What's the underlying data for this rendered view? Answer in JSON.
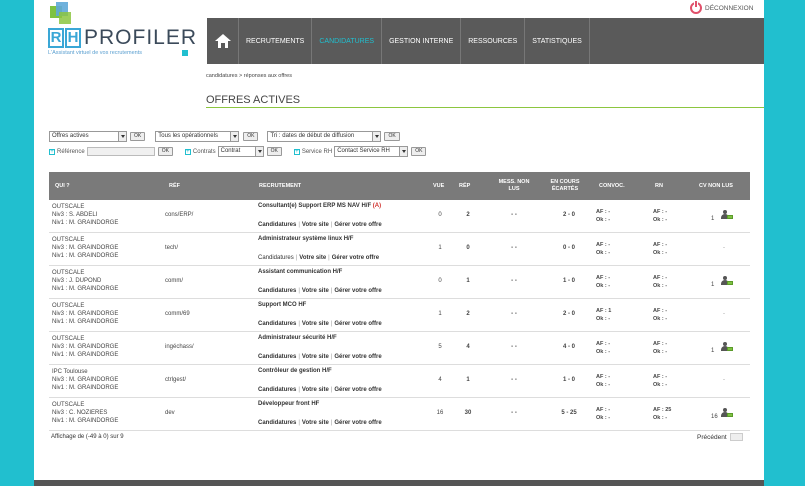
{
  "logo": {
    "rh_letters": [
      "R",
      "H"
    ],
    "name": "PROFILER",
    "tagline": "L'Assistant virtuel de vos recrutements"
  },
  "header": {
    "logout_label": "DÉCONNEXION"
  },
  "nav": {
    "items": [
      "RECRUTEMENTS",
      "CANDIDATURES",
      "GESTION INTERNE",
      "RESSOURCES",
      "STATISTIQUES"
    ],
    "active": "CANDIDATURES"
  },
  "breadcrumb": "candidatures > réponses aux offres",
  "page_title": "OFFRES ACTIVES",
  "filters": {
    "status_select": "Offres actives",
    "operationnels_select": "Tous les opérationnels",
    "tri_select": "Tri : dates de début de diffusion",
    "ok_label": "OK",
    "reference_label": "Référence",
    "contrats_label": "Contrats",
    "contrats_select": "Contrat",
    "service_label": "Service RH",
    "service_select": "Contact Service RH"
  },
  "table": {
    "headers": {
      "qui": "QUI ?",
      "ref": "RÉF",
      "recrutement": "RECRUTEMENT",
      "vue": "VUE",
      "rep": "RÉP",
      "mess": "MESS. NON LUS",
      "enc": "EN COURS ÉCARTÉS",
      "convoc": "CONVOC.",
      "rn": "RN",
      "cv": "CV NON LUS"
    },
    "links": {
      "candidatures": "Candidatures",
      "site": "Votre site",
      "gerer": "Gérer votre offre"
    },
    "rows": [
      {
        "q1": "OUTSCALE",
        "q2": "Niv3 : S. ABDELI",
        "q3": "Niv1 : M. GRAINDORGE",
        "ref": "cons/ERP/",
        "title": "Consultant(e) Support ERP MS NAV H/F",
        "alert": "(A)",
        "vue": "0",
        "rep": "2",
        "mess": "- -",
        "enc": "2 - 0",
        "af": "AF : -",
        "ok": "Ok : -",
        "rn_af": "AF : -",
        "rn_ok": "Ok : -",
        "cv": "1",
        "cv_icon": true,
        "bold": true
      },
      {
        "q1": "OUTSCALE",
        "q2": "Niv3 : M. GRAINDORGE",
        "q3": "Niv1 : M. GRAINDORGE",
        "ref": "tech/",
        "title": "Administrateur système linux H/F",
        "alert": "",
        "vue": "1",
        "rep": "0",
        "mess": "- -",
        "enc": "0 - 0",
        "af": "AF : -",
        "ok": "Ok : -",
        "rn_af": "AF : -",
        "rn_ok": "Ok : -",
        "cv": "-",
        "cv_icon": false,
        "bold": false
      },
      {
        "q1": "OUTSCALE",
        "q2": "Niv3 : J. DUPOND",
        "q3": "Niv1 : M. GRAINDORGE",
        "ref": "comm/",
        "title": "Assistant communication H/F",
        "alert": "",
        "vue": "0",
        "rep": "1",
        "mess": "- -",
        "enc": "1 - 0",
        "af": "AF : -",
        "ok": "Ok : -",
        "rn_af": "AF : -",
        "rn_ok": "Ok : -",
        "cv": "1",
        "cv_icon": true,
        "bold": true
      },
      {
        "q1": "OUTSCALE",
        "q2": "Niv3 : M. GRAINDORGE",
        "q3": "Niv1 : M. GRAINDORGE",
        "ref": "comm/69",
        "title": "Support MCO HF",
        "alert": "",
        "vue": "1",
        "rep": "2",
        "mess": "- -",
        "enc": "2 - 0",
        "af": "AF : 1",
        "ok": "Ok : -",
        "rn_af": "AF : -",
        "rn_ok": "Ok : -",
        "cv": "-",
        "cv_icon": false,
        "bold": true
      },
      {
        "q1": "OUTSCALE",
        "q2": "Niv3 : M. GRAINDORGE",
        "q3": "Niv1 : M. GRAINDORGE",
        "ref": "ingéchass/",
        "title": "Administrateur sécurité H/F",
        "alert": "",
        "vue": "5",
        "rep": "4",
        "mess": "- -",
        "enc": "4 - 0",
        "af": "AF : -",
        "ok": "Ok : -",
        "rn_af": "AF : -",
        "rn_ok": "Ok : -",
        "cv": "1",
        "cv_icon": true,
        "bold": true
      },
      {
        "q1": "IPC Toulouse",
        "q2": "Niv3 : M. GRAINDORGE",
        "q3": "Niv1 : M. GRAINDORGE",
        "ref": "ctrlgest/",
        "title": "Contrôleur de gestion H/F",
        "alert": "",
        "vue": "4",
        "rep": "1",
        "mess": "- -",
        "enc": "1 - 0",
        "af": "AF : -",
        "ok": "Ok : -",
        "rn_af": "AF : -",
        "rn_ok": "Ok : -",
        "cv": "-",
        "cv_icon": false,
        "bold": true
      },
      {
        "q1": "OUTSCALE",
        "q2": "Niv3 : C. NOZIERES",
        "q3": "Niv1 : M. GRAINDORGE",
        "ref": "dev",
        "title": "Développeur front HF",
        "alert": "",
        "vue": "16",
        "rep": "30",
        "mess": "- -",
        "enc": "5 - 25",
        "af": "AF : -",
        "ok": "Ok : -",
        "rn_af": "AF : 25",
        "rn_ok": "Ok : -",
        "cv": "16",
        "cv_icon": true,
        "bold": true
      }
    ]
  },
  "footer": {
    "pagination_info": "Affichage de (-49 à 0) sur 9",
    "prev_label": "Précédent"
  },
  "colors": {
    "accent": "#21bfcf",
    "green": "#8cc63f",
    "nav_bg": "#5a5a5a",
    "header_bg": "#7a7a7a",
    "alert": "#d0312d"
  }
}
